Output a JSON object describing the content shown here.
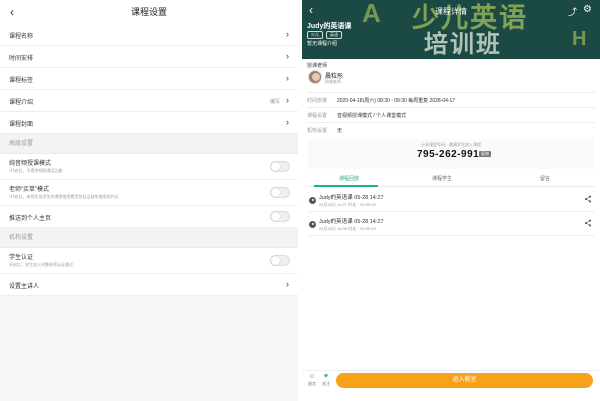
{
  "left": {
    "title": "课程设置",
    "back": "‹",
    "rows": [
      {
        "label": "课程名称",
        "chevron": "›"
      },
      {
        "label": "时间安排",
        "chevron": "›"
      },
      {
        "label": "课程标签",
        "chevron": "›"
      },
      {
        "label": "课程介绍",
        "extra": "编写",
        "chevron": "›"
      },
      {
        "label": "课程封面",
        "chevron": "›"
      }
    ],
    "advanced_header": "高级设置",
    "toggles": [
      {
        "label": "纯音频授课模式",
        "sub": "*开启后，不提供视频通话功能"
      },
      {
        "label": "老师“买单”模式",
        "sub": "*开启后，老师负担学生的课堂使用费用包括当前所使用的时长"
      },
      {
        "label": "推送到个人主页",
        "sub": ""
      }
    ],
    "org_header": "机构设置",
    "org_toggle": {
      "label": "学生认证",
      "sub": "开启后，学生加入时需老师认证通过"
    },
    "main_teacher": {
      "label": "设置主讲人",
      "chevron": "›"
    }
  },
  "right": {
    "title": "课程详情",
    "back": "‹",
    "share_icon": "⤴",
    "gear_icon": "⚙",
    "banner_text_1": "少儿英语",
    "banner_text_2": "培训班",
    "course_name": "Judy的英语课",
    "tags": [
      "少儿",
      "英语"
    ],
    "intro": "暂无课程介绍",
    "teacher_section": "授课老师",
    "teacher_name": "晨粒彤",
    "teacher_role": "授课老师",
    "time_key": "时间安排",
    "time_value": "2020-04-18(周六) 08:30 - 09:30 每周重复 2028-04-17",
    "mode_key": "课程设置",
    "mode_value": "音视频授课模式 / 个人课堂模式",
    "org_key": "机构设置",
    "org_value": "无",
    "share_hint": "分享课程号码，邀请学生加入课程",
    "course_code": "795-262-991",
    "copy_label": "复制",
    "tabs": [
      "课程回放",
      "课程学生",
      "留言"
    ],
    "lessons": [
      {
        "title": "Judy的英语课 05-28 14:27",
        "sub": "05月28日 14:27    时长：00:00:09"
      },
      {
        "title": "Judy的英语课 05-28 14:27",
        "sub": "05月28日 16:38    时长：00:00:43"
      }
    ],
    "bottom_items": [
      {
        "icon": "☺",
        "label": "留言"
      },
      {
        "icon": "♥",
        "label": "关注"
      }
    ],
    "enter_label": "进入教室"
  }
}
